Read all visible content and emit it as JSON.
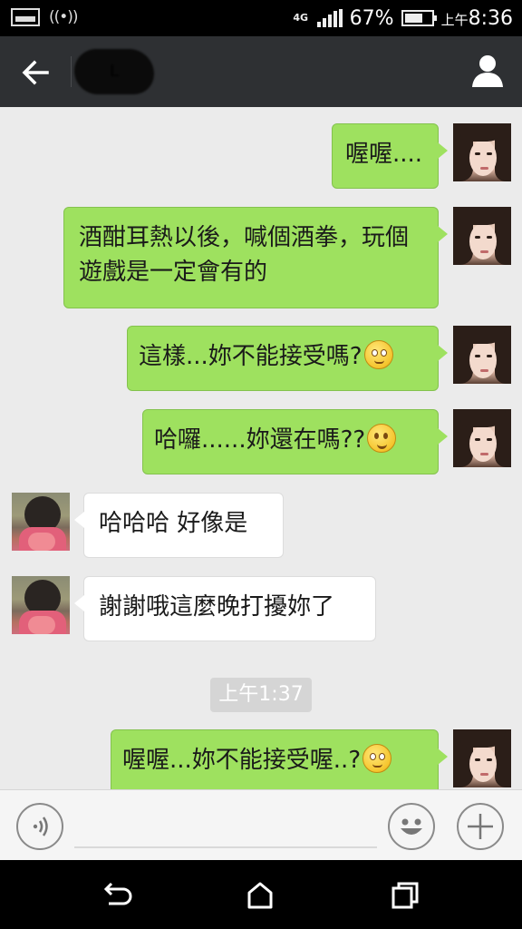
{
  "status_bar": {
    "network": "4G",
    "battery_percent": "67%",
    "battery_level": 0.67,
    "time_prefix": "上午",
    "time": "8:36"
  },
  "header": {
    "contact_name": "L"
  },
  "messages": [
    {
      "sender": "me",
      "text": "喔喔...."
    },
    {
      "sender": "me",
      "text": "酒酣耳熱以後，喊個酒拳，玩個遊戲是一定會有的"
    },
    {
      "sender": "me",
      "text": "這樣...妳不能接受嗎?",
      "emoji": "embarrassed-emoji"
    },
    {
      "sender": "me",
      "text": "哈囉......妳還在嗎??",
      "emoji": "smile-emoji"
    },
    {
      "sender": "other",
      "text": "哈哈哈 好像是"
    },
    {
      "sender": "other",
      "text": "謝謝哦這麼晚打擾妳了"
    },
    {
      "sender": "me",
      "text": "喔喔...妳不能接受喔..?",
      "emoji": "embarrassed-emoji"
    }
  ],
  "timestamp": "上午1:37",
  "input": {
    "value": "",
    "placeholder": ""
  },
  "icons": {
    "back": "back-arrow-icon",
    "profile": "person-icon",
    "voice": "voice-icon",
    "emoji": "emoji-icon",
    "plus": "plus-icon",
    "nav_back": "nav-back-icon",
    "nav_home": "home-icon",
    "nav_recents": "recents-icon"
  },
  "colors": {
    "header_bg": "#2e3033",
    "chat_bg": "#ebebeb",
    "my_bubble": "#9ee15f",
    "their_bubble": "#ffffff"
  }
}
